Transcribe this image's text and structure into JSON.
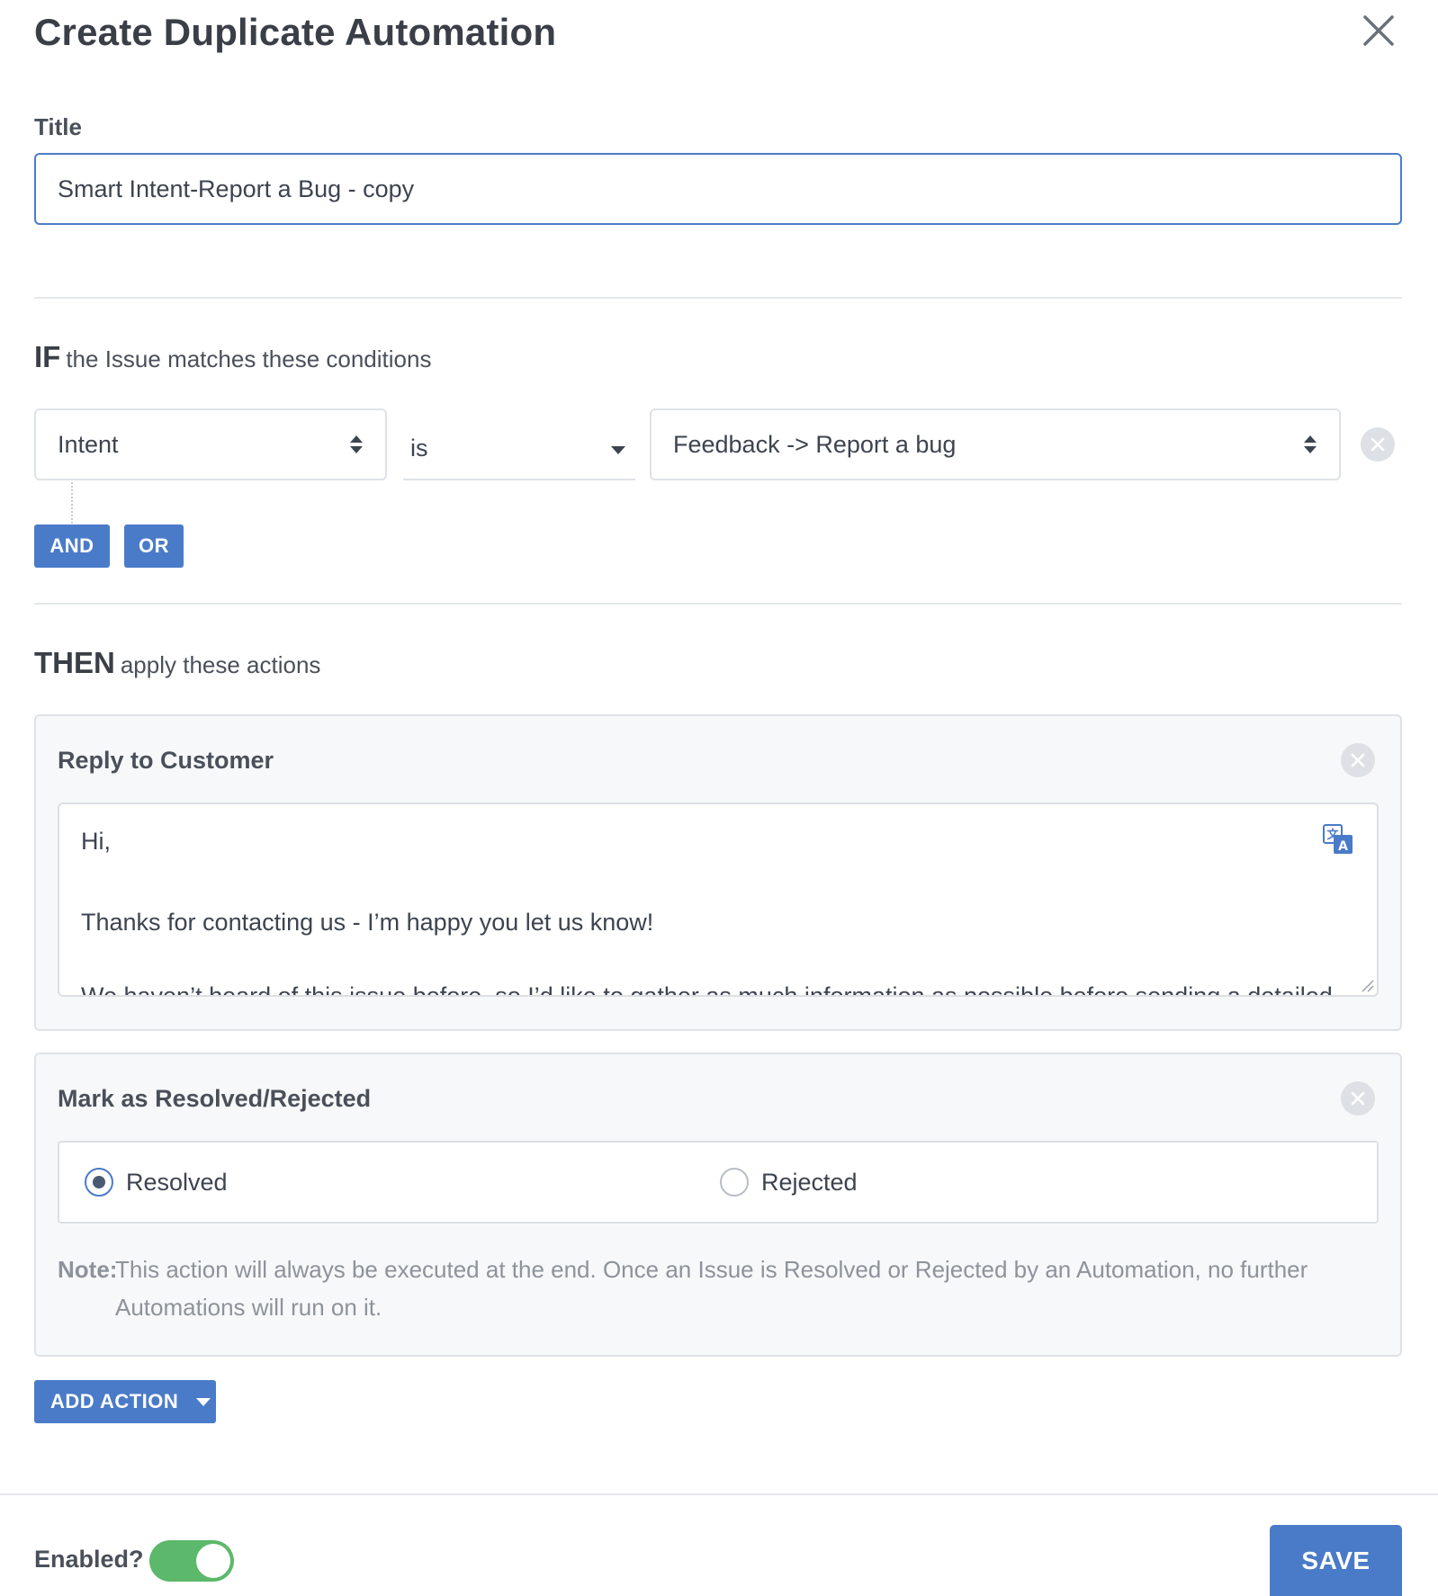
{
  "header": {
    "title": "Create Duplicate Automation",
    "close_icon": "close-icon"
  },
  "title_field": {
    "label": "Title",
    "value": "Smart Intent-Report a Bug - copy"
  },
  "conditions": {
    "heading_kw": "IF",
    "heading_text": "the Issue matches these conditions",
    "field_value": "Intent",
    "operator_value": "is",
    "target_value": "Feedback -> Report a bug",
    "and_label": "AND",
    "or_label": "OR"
  },
  "actions": {
    "heading_kw": "THEN",
    "heading_text": "apply these actions",
    "reply": {
      "title": "Reply to Customer",
      "line1": "Hi,",
      "line2": "Thanks for contacting us - I’m happy you let us know!",
      "line3": "We haven’t heard of this issue before, so I’d like to gather as much information as possible before sending a detailed"
    },
    "mark": {
      "title": "Mark as Resolved/Rejected",
      "option_resolved": "Resolved",
      "option_rejected": "Rejected",
      "selected": "Resolved",
      "note_label": "Note:",
      "note_text": "This action will always be executed at the end. Once an Issue is Resolved or Rejected by an Automation, no further Automations will run on it."
    },
    "add_action_label": "ADD ACTION"
  },
  "footer": {
    "enabled_label": "Enabled?",
    "enabled": true,
    "save_label": "SAVE"
  },
  "colors": {
    "primary": "#4a7bc8",
    "toggle_on": "#5cb86b",
    "border": "#dfe2e6",
    "text": "#3d4450"
  }
}
